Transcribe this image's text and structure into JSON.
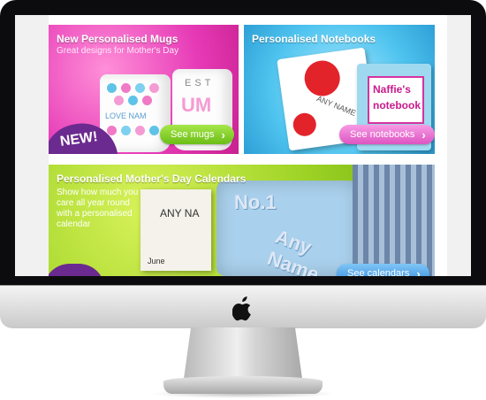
{
  "panels": {
    "mugs": {
      "title": "New Personalised Mugs",
      "subtitle": "Great designs for Mother's Day",
      "badge": "NEW!",
      "button_label": "See mugs",
      "mug_text_1": "EST",
      "mug_text_2": "LOVE NAM",
      "mug_text_3": "UM"
    },
    "notebooks": {
      "title": "Personalised Notebooks",
      "button_label": "See notebooks",
      "notebook_text_1": "ANY NAME",
      "notebook_text_2": "Naffie's",
      "notebook_text_3": "notebook"
    },
    "calendars": {
      "title": "Personalised Mother's Day Calendars",
      "subtitle_lines": [
        "Show how much you",
        "care all year round",
        "with a personalised",
        "calendar"
      ],
      "button_label": "See calendars",
      "card_text_1": "ANY NA",
      "card_text_2": "June",
      "blanket_text_1": "No.1",
      "blanket_text_2": "Any Name"
    }
  },
  "icons": {
    "button_chevron": "chevron-right-icon",
    "monitor_logo": "apple-logo-icon"
  },
  "colors": {
    "mugs_bg": "#e63ab6",
    "notebooks_bg": "#4fc4ef",
    "calendars_bg": "#9ed325",
    "new_badge": "#6b2a8f",
    "button_green": "#6cbd17",
    "button_pink": "#dd54c2",
    "button_blue": "#3a8fe0"
  }
}
